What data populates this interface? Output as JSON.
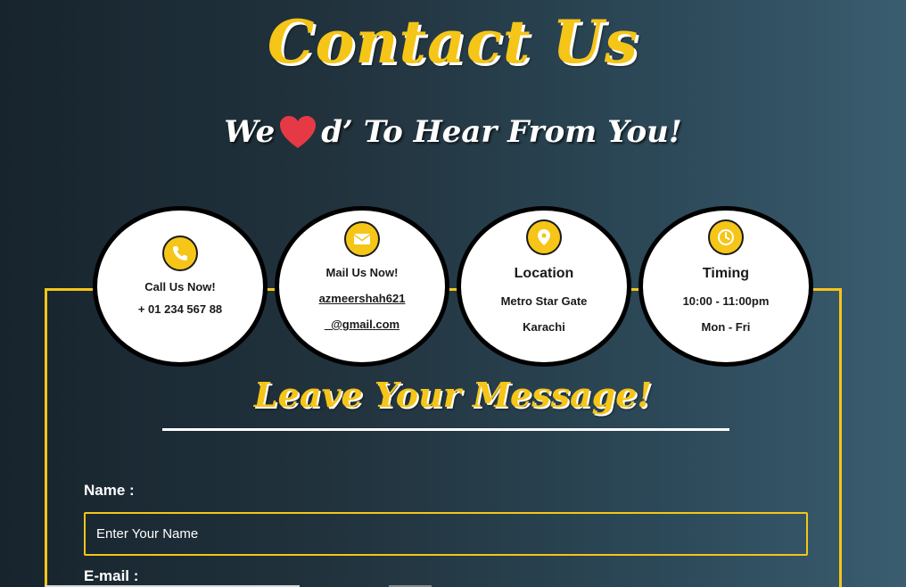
{
  "header": {
    "title": "Contact Us",
    "subtitle_before": "We",
    "subtitle_after": "d’ To Hear From You!"
  },
  "cards": [
    {
      "icon": "phone-icon",
      "label": "Call Us Now!",
      "line1": "+ 01 234 567 88",
      "line2": ""
    },
    {
      "icon": "envelope-icon",
      "label": "Mail Us Now!",
      "line1": "azmeershah621",
      "line2": "_@gmail.com"
    },
    {
      "icon": "location-pin-icon",
      "label": "Location",
      "line1": "Metro Star Gate",
      "line2": "Karachi"
    },
    {
      "icon": "clock-icon",
      "label": "Timing",
      "line1": "10:00 - 11:00pm",
      "line2": "Mon - Fri"
    }
  ],
  "form": {
    "heading": "Leave Your Message!",
    "name_label": "Name :",
    "name_placeholder": "Enter Your Name",
    "name_value": "",
    "email_label": "E-mail :"
  },
  "colors": {
    "accent": "#f5c518",
    "heart": "#e63946",
    "card_bg": "#ffffff",
    "card_border": "#000000"
  }
}
